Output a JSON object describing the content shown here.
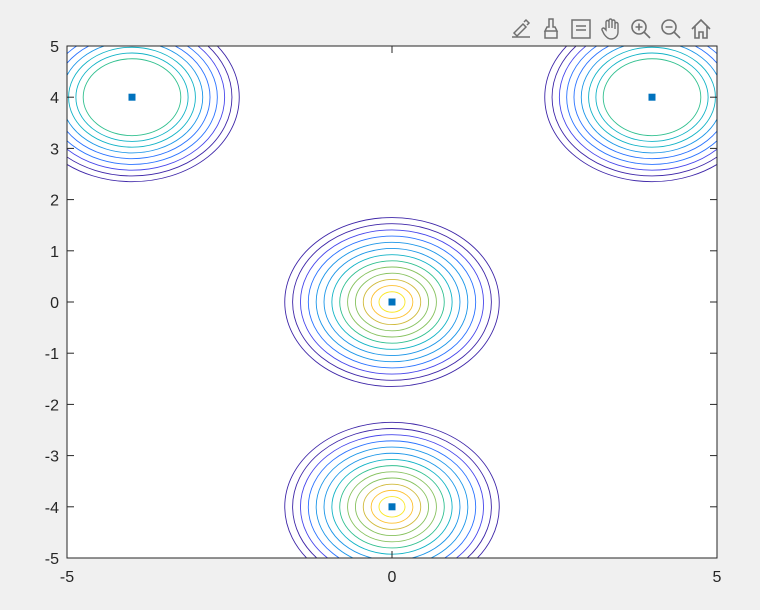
{
  "toolbar": {
    "icons": [
      "edit-plot-icon",
      "brush-icon",
      "data-tips-icon",
      "pan-hand-icon",
      "zoom-in-icon",
      "zoom-out-icon",
      "home-icon"
    ]
  },
  "chart_data": {
    "type": "contour",
    "title": "",
    "xlabel": "",
    "ylabel": "",
    "xlim": [
      -5,
      5
    ],
    "ylim": [
      -5,
      5
    ],
    "x_ticks": [
      "-5",
      "0",
      "5"
    ],
    "y_ticks": [
      "-5",
      "-4",
      "-3",
      "-2",
      "-1",
      "0",
      "1",
      "2",
      "3",
      "4",
      "5"
    ],
    "grid": false,
    "colormap": [
      "#3e26a8",
      "#4746eb",
      "#2b73ff",
      "#1c96e8",
      "#12b3c6",
      "#32c090",
      "#87c25f",
      "#d0ba3b",
      "#fdc031",
      "#f9e726"
    ],
    "peaks": [
      {
        "x": -4,
        "y": 4,
        "levels": 9
      },
      {
        "x": 4,
        "y": 4,
        "levels": 9
      },
      {
        "x": 0,
        "y": 0,
        "levels": 13
      },
      {
        "x": 0,
        "y": -4,
        "levels": 13
      }
    ],
    "markers": [
      {
        "x": -4,
        "y": 4
      },
      {
        "x": 4,
        "y": 4
      },
      {
        "x": 0,
        "y": 0
      },
      {
        "x": 0,
        "y": -4
      }
    ],
    "marker_color": "#0072bd"
  }
}
